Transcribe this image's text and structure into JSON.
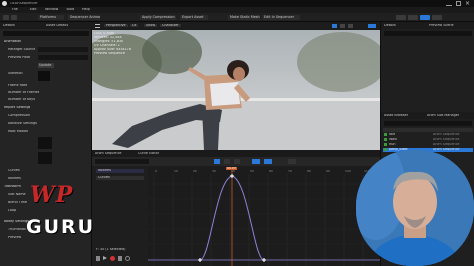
{
  "window": {
    "title": "OEDnSequencer"
  },
  "menu": {
    "items": [
      "File",
      "Edit",
      "Window",
      "Tools",
      "Build",
      "Select",
      "Actor",
      "Help"
    ]
  },
  "toolbar": {
    "platforms": "Platforms",
    "sequencer_anim": "Sequencer Animation",
    "apply_compression": "Apply Compression",
    "export_asset": "Export Asset",
    "make_static_mesh": "Make Static Mesh",
    "edit_in_sequencer": "Edit In Sequencer"
  },
  "left_panel": {
    "tabs": [
      "Details",
      "Asset Details"
    ],
    "rows": [
      "Animation",
      "Retarget Source",
      "Preview Pose",
      "Skeleton",
      "Frame Rate",
      "Number of Frames",
      "Number of Keys",
      "Import Settings",
      "Compression",
      "Additive Settings",
      "Root Motion",
      "Curves",
      "Notifies",
      "Transform",
      "Slot Name",
      "Blend Time",
      "Loop",
      "Notify Settings",
      "Thumbnail",
      "Preview"
    ],
    "highlight": "Update"
  },
  "viewport": {
    "tabs": [
      "Perspective",
      "Lit",
      "Show",
      "Character"
    ],
    "stats": [
      "LOD: 0 Auto",
      "Vertices: 32,584",
      "Triangles: 51,830",
      "UV Channels: 1",
      "Approx Size: 4x3x178",
      "Preview Sequence"
    ]
  },
  "sequencer": {
    "tabs": [
      "Curve Editor"
    ],
    "header": "Anim Sequence",
    "frame": "0039",
    "frame_readout": "F: 30 (1 selected)",
    "track_labels": [
      "Notifies",
      "Curves"
    ],
    "time_marks": [
      "0",
      "10",
      "20",
      "30",
      "40",
      "50",
      "60",
      "70",
      "80",
      "90",
      "100",
      "110"
    ]
  },
  "right_panel": {
    "tabs": [
      "Details",
      "Preview Scene"
    ],
    "bottom_tabs": [
      "Asset Browser",
      "Anim Slot Manager"
    ],
    "list_items": [
      "Idle",
      "Walk",
      "Run",
      "Jump_Start",
      "Jump_Loop",
      "Kick_Side",
      "Kick_Front"
    ],
    "list_types": [
      "Anim Sequence",
      "Anim Sequence",
      "Anim Sequence",
      "Anim Sequence",
      "Anim Sequence",
      "Anim Sequence",
      "Anim Sequence"
    ]
  },
  "overlay": {
    "logo_line1": "WP",
    "logo_line2": "GURU"
  },
  "colors": {
    "accent": "#2a78d8",
    "curve": "#8e83d8",
    "highlight": "#3a9d3a",
    "logo_red": "#c62828"
  }
}
